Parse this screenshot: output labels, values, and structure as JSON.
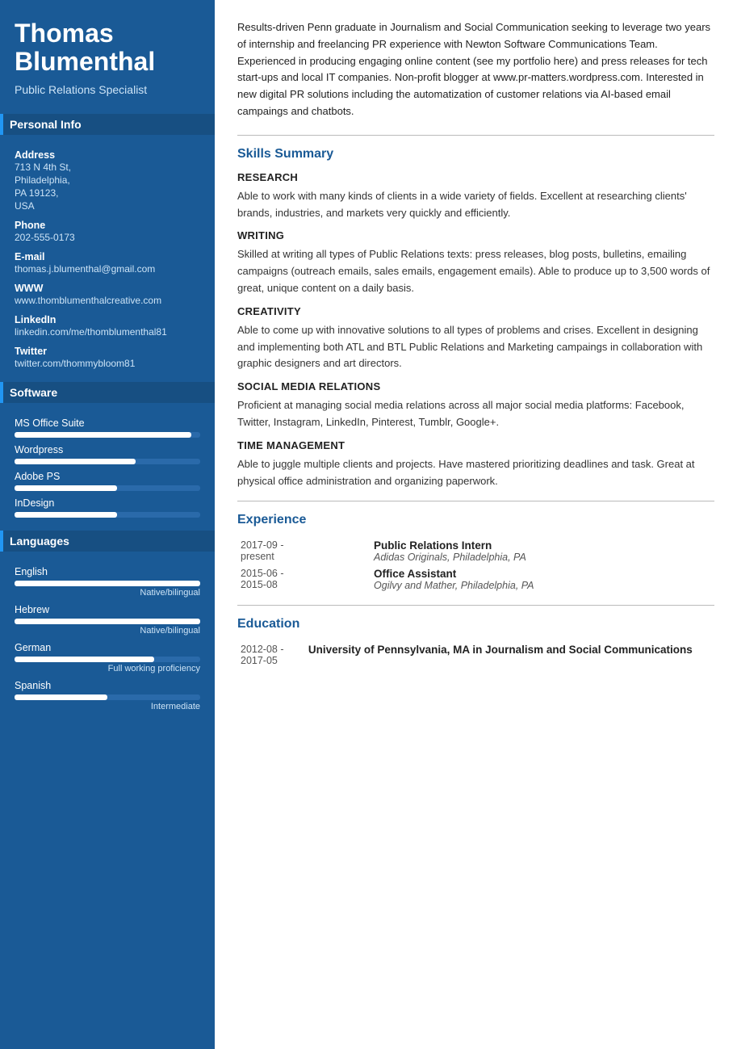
{
  "sidebar": {
    "name": "Thomas Blumenthal",
    "title": "Public Relations Specialist",
    "sections": {
      "personal_info": {
        "label": "Personal Info",
        "address_label": "Address",
        "address_lines": [
          "713 N 4th St,",
          "Philadelphia,",
          "PA 19123,",
          "USA"
        ],
        "phone_label": "Phone",
        "phone": "202-555-0173",
        "email_label": "E-mail",
        "email": "thomas.j.blumenthal@gmail.com",
        "www_label": "WWW",
        "www": "www.thomblumenthalcreative.com",
        "linkedin_label": "LinkedIn",
        "linkedin": "linkedin.com/me/thomblumenthal81",
        "twitter_label": "Twitter",
        "twitter": "twitter.com/thommybloom81"
      },
      "software": {
        "label": "Software",
        "items": [
          {
            "name": "MS Office Suite",
            "pct": 95
          },
          {
            "name": "Wordpress",
            "pct": 65
          },
          {
            "name": "Adobe PS",
            "pct": 55
          },
          {
            "name": "InDesign",
            "pct": 55
          }
        ]
      },
      "languages": {
        "label": "Languages",
        "items": [
          {
            "name": "English",
            "pct": 100,
            "level": "Native/bilingual"
          },
          {
            "name": "Hebrew",
            "pct": 100,
            "level": "Native/bilingual"
          },
          {
            "name": "German",
            "pct": 75,
            "level": "Full working proficiency"
          },
          {
            "name": "Spanish",
            "pct": 50,
            "level": "Intermediate"
          }
        ]
      }
    }
  },
  "main": {
    "summary": "Results-driven Penn graduate in Journalism and Social Communication seeking to leverage two years of internship and freelancing PR experience with Newton Software Communications Team. Experienced in producing engaging online content (see my portfolio here) and press releases for tech start-ups and local IT companies. Non-profit blogger at www.pr-matters.wordpress.com. Interested in new digital PR solutions including the automatization of customer relations via AI-based email campaings and chatbots.",
    "skills_title": "Skills Summary",
    "skills": [
      {
        "category": "RESEARCH",
        "desc": "Able to work with many kinds of clients in a wide variety of fields. Excellent at researching clients' brands, industries, and markets very quickly and efficiently."
      },
      {
        "category": "WRITING",
        "desc": "Skilled at writing all types of Public Relations texts: press releases, blog posts, bulletins, emailing campaigns (outreach emails, sales emails, engagement emails). Able to produce up to 3,500 words of great, unique content on a daily basis."
      },
      {
        "category": "CREATIVITY",
        "desc": "Able to come up with innovative solutions to all types of problems and crises. Excellent in designing and implementing both ATL and BTL Public Relations and Marketing campaings in collaboration with graphic designers and art directors."
      },
      {
        "category": "SOCIAL MEDIA RELATIONS",
        "desc": "Proficient at managing social media relations across all major social media platforms: Facebook, Twitter, Instagram, LinkedIn, Pinterest, Tumblr, Google+."
      },
      {
        "category": "TIME MANAGEMENT",
        "desc": "Able to juggle multiple clients and projects. Have mastered prioritizing deadlines and task. Great at physical office administration and organizing paperwork."
      }
    ],
    "experience_title": "Experience",
    "experience": [
      {
        "date": "2017-09 - present",
        "role": "Public Relations Intern",
        "org": "Adidas Originals, Philadelphia, PA"
      },
      {
        "date": "2015-06 - 2015-08",
        "role": "Office Assistant",
        "org": "Ogilvy and Mather, Philadelphia, PA"
      }
    ],
    "education_title": "Education",
    "education": [
      {
        "date": "2012-08 - 2017-05",
        "degree": "University of Pennsylvania, MA in Journalism and Social Communications"
      }
    ]
  }
}
